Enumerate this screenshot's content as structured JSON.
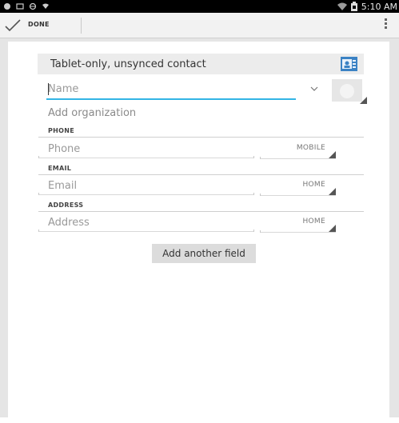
{
  "status_bar": {
    "left_icons": [
      "android-icon",
      "gallery-icon",
      "sync-icon",
      "download-icon"
    ],
    "right_icons": [
      "wifi-icon",
      "battery-icon"
    ],
    "time": "5:10 AM"
  },
  "action_bar": {
    "done_label": "DONE",
    "done_icon": "check-icon",
    "overflow_icon": "overflow-menu-icon"
  },
  "editor": {
    "account_header": "Tablet-only, unsynced contact",
    "account_icon": "contact-card-icon",
    "name": {
      "placeholder": "Name",
      "value": ""
    },
    "add_organization": "Add organization",
    "sections": [
      {
        "title": "PHONE",
        "placeholder": "Phone",
        "type": "MOBILE"
      },
      {
        "title": "EMAIL",
        "placeholder": "Email",
        "type": "HOME"
      },
      {
        "title": "ADDRESS",
        "placeholder": "Address",
        "type": "HOME"
      }
    ],
    "add_field_label": "Add another field"
  },
  "colors": {
    "accent": "#33b5e5",
    "status_bar_bg": "#000000",
    "action_bar_bg": "#f2f2f2",
    "screen_bg": "#e5e5e5",
    "card_bg": "#ffffff"
  }
}
